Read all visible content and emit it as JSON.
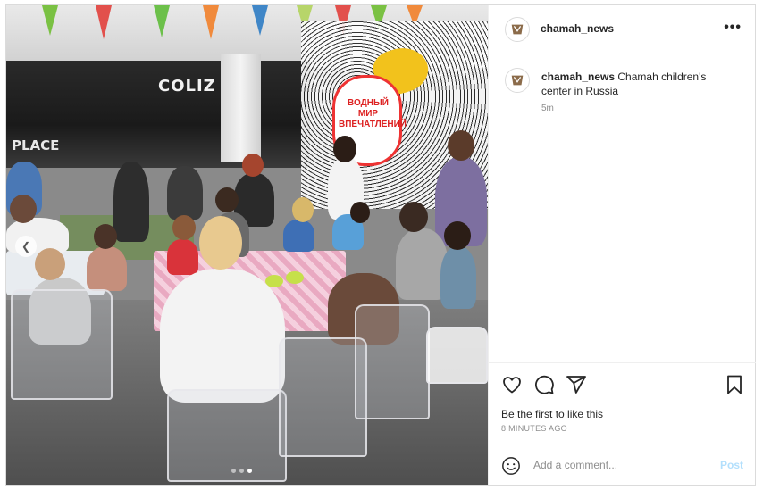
{
  "post": {
    "username": "chamah_news",
    "more_icon": "ellipsis-icon",
    "caption": "Chamah children's center in Russia",
    "caption_age": "5m",
    "likes_text": "Be the first to like this",
    "post_date": "8 MINUTES AGO",
    "comment_placeholder": "Add a comment...",
    "post_label": "Post",
    "carousel": {
      "slides": 3,
      "current_slide": 3
    }
  },
  "photo": {
    "sign_main": "COLIZ",
    "sign_secondary": "PLACE",
    "mural_text": "ВОДНЫЙ МИР ВПЕЧАТЛЕНИЙ"
  },
  "colors": {
    "text_primary": "#262626",
    "text_secondary": "#8e8e8e",
    "border": "#dbdbdb",
    "post_disabled": "#b2dffc"
  },
  "icons": [
    "heart-icon",
    "comment-icon",
    "share-icon",
    "bookmark-icon",
    "emoji-icon",
    "avatar-logo-icon",
    "chevron-left-icon"
  ]
}
